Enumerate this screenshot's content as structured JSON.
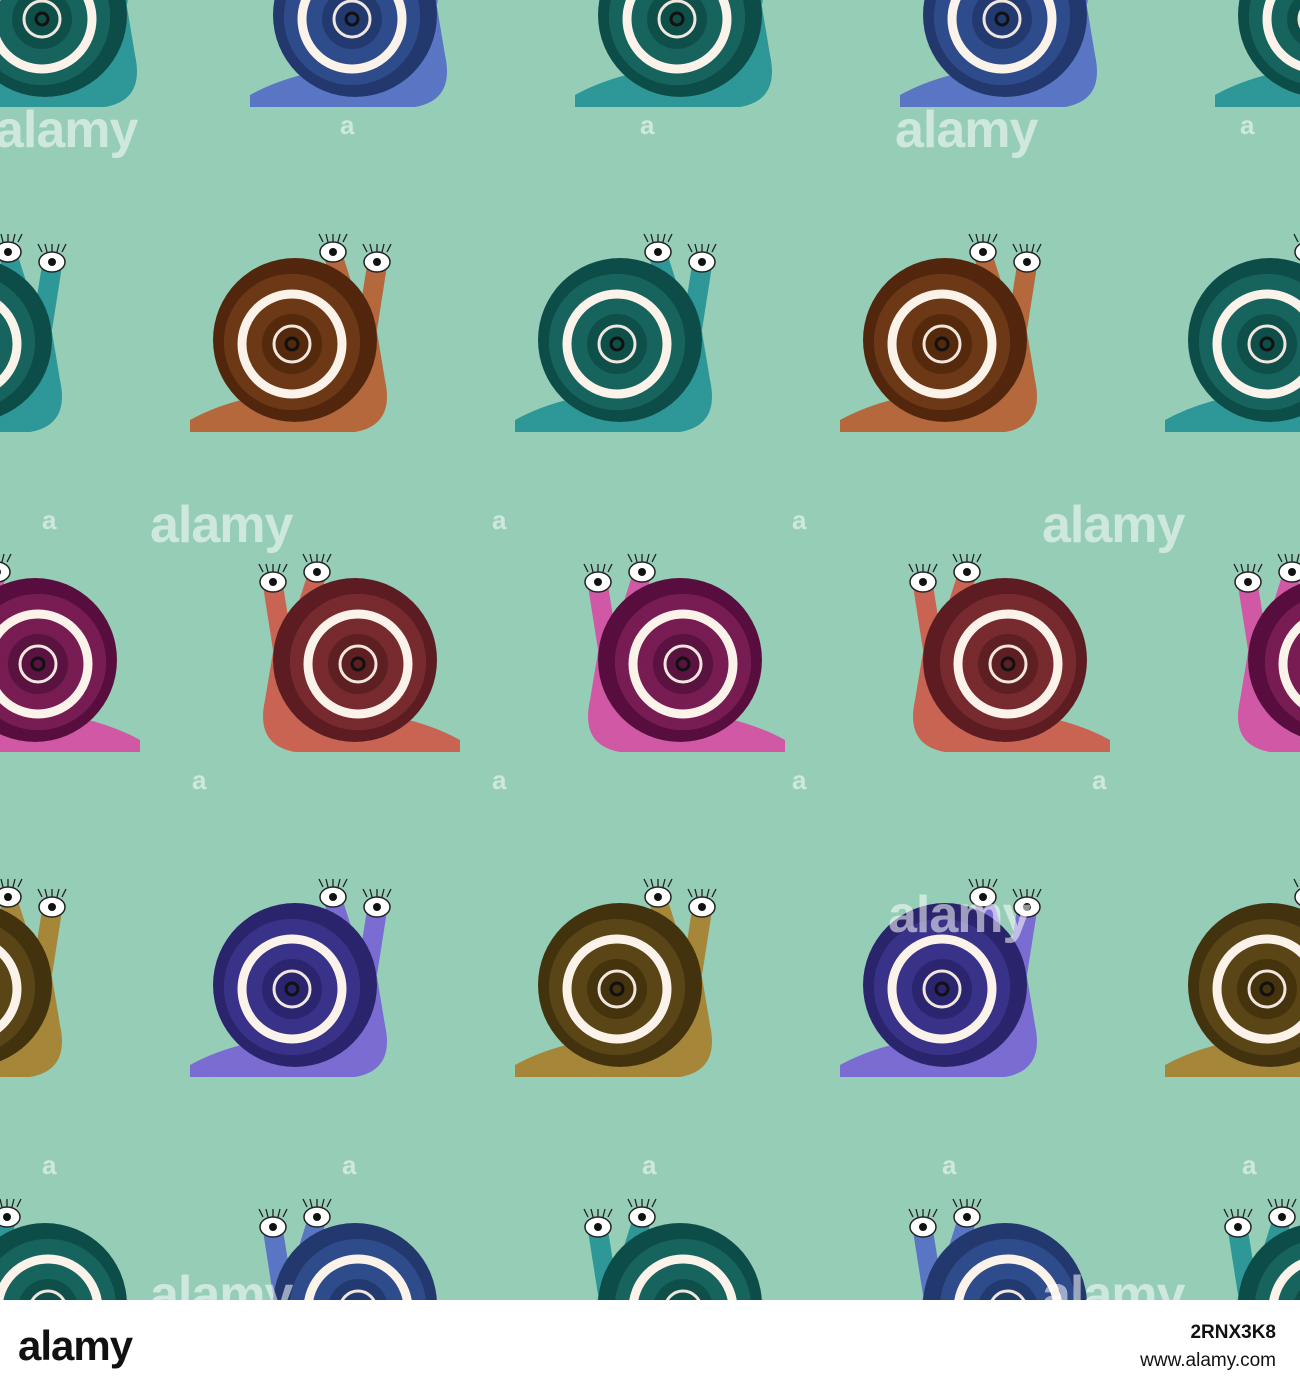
{
  "image": {
    "background_color": "#95cdb7",
    "subject": "snail",
    "palette": {
      "teal": {
        "shell": "#15665f",
        "ring": "#0f4f4a",
        "body": "#2e9a9a"
      },
      "blue": {
        "shell": "#2f4d8e",
        "ring": "#233a70",
        "body": "#5b78c8"
      },
      "brown": {
        "shell": "#6e3a14",
        "ring": "#54290c",
        "body": "#b86a3c"
      },
      "wine": {
        "shell": "#7a2d30",
        "ring": "#5e1f22",
        "body": "#cd6655"
      },
      "magenta": {
        "shell": "#7a1c55",
        "ring": "#5a1240",
        "body": "#d45aa8"
      },
      "indigo": {
        "shell": "#3a338c",
        "ring": "#2a256e",
        "body": "#7d6ed6"
      },
      "olive": {
        "shell": "#5c4614",
        "ring": "#44330c",
        "body": "#a9893a"
      }
    }
  },
  "watermark": {
    "brand": "alamy",
    "mark": "a"
  },
  "footer": {
    "logo": "alamy",
    "image_id": "2RNX3K8",
    "url": "www.alamy.com"
  }
}
